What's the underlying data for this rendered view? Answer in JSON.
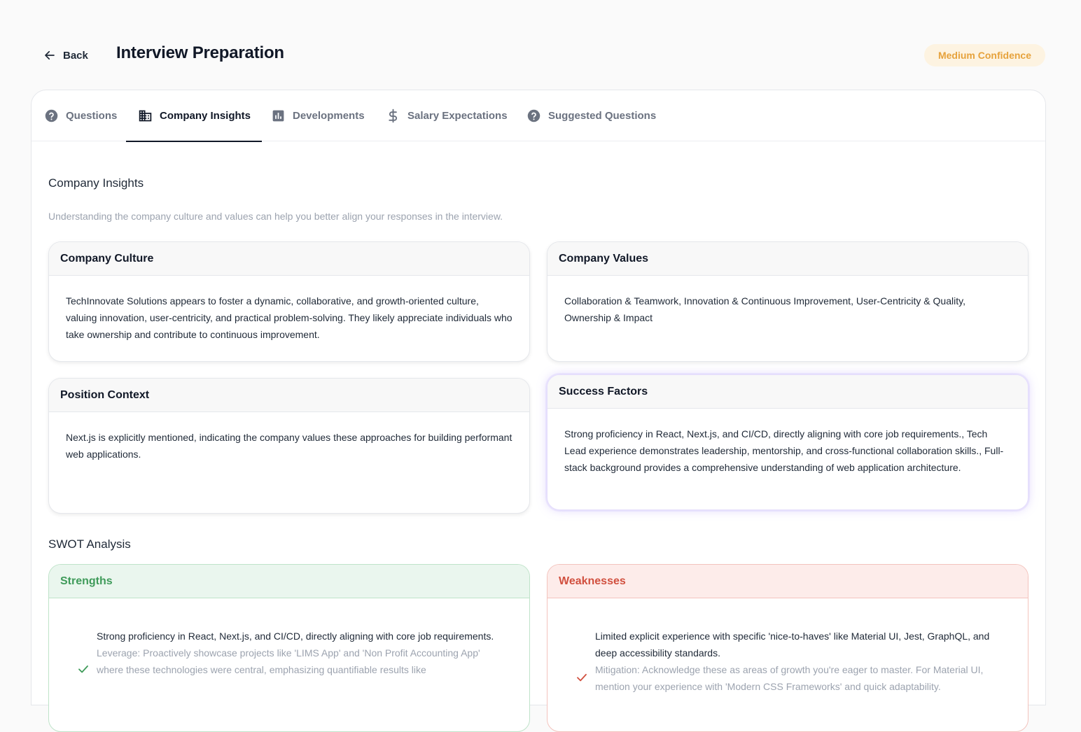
{
  "header": {
    "back_label": "Back",
    "title": "Interview Preparation",
    "confidence_badge": "Medium Confidence"
  },
  "tabs": [
    {
      "label": "Questions",
      "icon": "question-circle-icon",
      "active": false
    },
    {
      "label": "Company Insights",
      "icon": "building-icon",
      "active": true
    },
    {
      "label": "Developments",
      "icon": "bar-chart-icon",
      "active": false
    },
    {
      "label": "Salary Expectations",
      "icon": "dollar-icon",
      "active": false
    },
    {
      "label": "Suggested Questions",
      "icon": "question-circle-icon",
      "active": false
    }
  ],
  "insights": {
    "title": "Company Insights",
    "description": "Understanding the company culture and values can help you better align your responses in the interview.",
    "culture": {
      "title": "Company Culture",
      "text": "TechInnovate Solutions appears to foster a dynamic, collaborative, and growth-oriented culture, valuing innovation, user-centricity, and practical problem-solving. They likely appreciate individuals who take ownership and contribute to continuous improvement."
    },
    "values": {
      "title": "Company Values",
      "text": "Collaboration & Teamwork, Innovation & Continuous Improvement, User-Centricity & Quality, Ownership & Impact"
    },
    "position": {
      "title": "Position Context",
      "text": "Next.js is explicitly mentioned, indicating the company values these approaches for building performant web applications."
    },
    "success": {
      "title": "Success Factors",
      "text": "Strong proficiency in React, Next.js, and CI/CD, directly aligning with core job requirements., Tech Lead experience demonstrates leadership, mentorship, and cross-functional collaboration skills., Full-stack background provides a comprehensive understanding of web application architecture."
    }
  },
  "swot": {
    "title": "SWOT Analysis",
    "strengths": {
      "title": "Strengths",
      "color": "#3f9b5a",
      "items": [
        {
          "text": "Strong proficiency in React, Next.js, and CI/CD, directly aligning with core job requirements.",
          "sub": "Leverage: Proactively showcase projects like 'LIMS App' and 'Non Profit Accounting App' where these technologies were central, emphasizing quantifiable results like"
        }
      ]
    },
    "weaknesses": {
      "title": "Weaknesses",
      "color": "#d1503f",
      "items": [
        {
          "text": "Limited explicit experience with specific 'nice-to-haves' like Material UI, Jest, GraphQL, and deep accessibility standards.",
          "sub": "Mitigation: Acknowledge these as areas of growth you're eager to master. For Material UI, mention your experience with 'Modern CSS Frameworks' and quick adaptability."
        }
      ]
    }
  }
}
